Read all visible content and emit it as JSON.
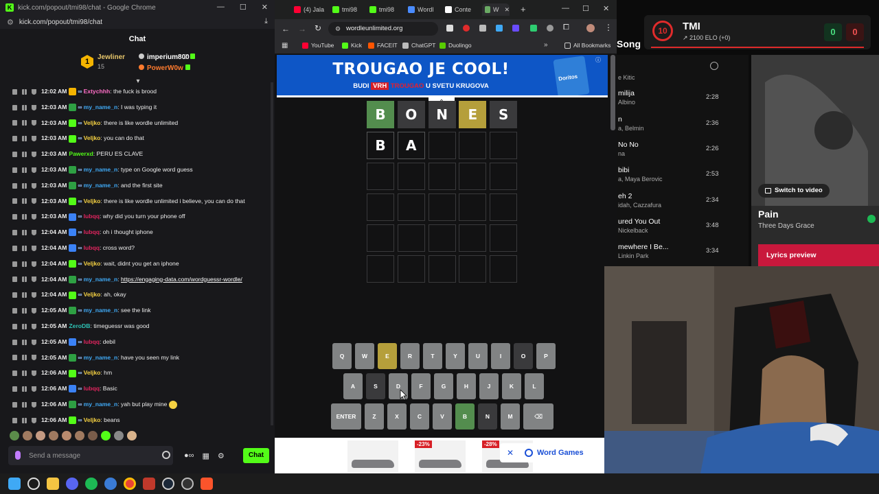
{
  "chat_window": {
    "title": "kick.com/popout/tmi98/chat - Google Chrome",
    "url": "kick.com/popout/tmi98/chat",
    "header": "Chat",
    "leaderboard": {
      "first_name": "Jewliner",
      "first_count": "15",
      "second_name": "imperium800",
      "second_count": "2",
      "third_name": "PowerW0w",
      "first_rank": "1"
    },
    "messages": [
      {
        "time": "12:02 AM",
        "user": "Extychhh",
        "color": "#ff6ec7",
        "badge": "y",
        "text": ": the fuck is brood"
      },
      {
        "time": "12:03 AM",
        "user": "my_name_n",
        "color": "#3fa9f5",
        "badge": "g",
        "text": ": I was typing it"
      },
      {
        "time": "12:03 AM",
        "user": "Veljko",
        "color": "#f5d142",
        "badge": "k",
        "text": ": there is like wordle unlimited"
      },
      {
        "time": "12:03 AM",
        "user": "Veljko",
        "color": "#f5d142",
        "badge": "k",
        "text": ": you can do that"
      },
      {
        "time": "12:03 AM",
        "user": "Pawerxd",
        "color": "#53fc18",
        "badge": "",
        "text": ": PERU ES CLAVE"
      },
      {
        "time": "12:03 AM",
        "user": "my_name_n",
        "color": "#3fa9f5",
        "badge": "g",
        "text": ": type on Google word guess"
      },
      {
        "time": "12:03 AM",
        "user": "my_name_n",
        "color": "#3fa9f5",
        "badge": "g",
        "text": ": and the first site"
      },
      {
        "time": "12:03 AM",
        "user": "Veljko",
        "color": "#f5d142",
        "badge": "k",
        "text": ": there is like wordle unlimited i believe, you can do that"
      },
      {
        "time": "12:03 AM",
        "user": "lubqq",
        "color": "#e0245e",
        "badge": "b",
        "text": ": why did you turn your phone off"
      },
      {
        "time": "12:04 AM",
        "user": "lubqq",
        "color": "#e0245e",
        "badge": "b",
        "text": ": oh i thought iphone"
      },
      {
        "time": "12:04 AM",
        "user": "lubqq",
        "color": "#e0245e",
        "badge": "b",
        "text": ": cross word?"
      },
      {
        "time": "12:04 AM",
        "user": "Veljko",
        "color": "#f5d142",
        "badge": "k",
        "text": ": wait, didnt you get an iphone"
      },
      {
        "time": "12:04 AM",
        "user": "my_name_n",
        "color": "#3fa9f5",
        "badge": "g",
        "text": ": ",
        "link": "https://engaging-data.com/wordguessr-wordle/"
      },
      {
        "time": "12:04 AM",
        "user": "Veljko",
        "color": "#f5d142",
        "badge": "k",
        "text": ": ah, okay"
      },
      {
        "time": "12:05 AM",
        "user": "my_name_n",
        "color": "#3fa9f5",
        "badge": "g",
        "text": ": see the link"
      },
      {
        "time": "12:05 AM",
        "user": "ZeroDB",
        "color": "#2ec4b6",
        "badge": "",
        "text": ": timeguessr was good"
      },
      {
        "time": "12:05 AM",
        "user": "lubqq",
        "color": "#e0245e",
        "badge": "b",
        "text": ": debil"
      },
      {
        "time": "12:05 AM",
        "user": "my_name_n",
        "color": "#3fa9f5",
        "badge": "g",
        "text": ": have you seen my link"
      },
      {
        "time": "12:06 AM",
        "user": "Veljko",
        "color": "#f5d142",
        "badge": "k",
        "text": ": hm"
      },
      {
        "time": "12:06 AM",
        "user": "lubqq",
        "color": "#e0245e",
        "badge": "b",
        "text": ": Basic"
      },
      {
        "time": "12:06 AM",
        "user": "my_name_n",
        "color": "#3fa9f5",
        "badge": "g",
        "text": ": yah but play mine"
      },
      {
        "time": "12:06 AM",
        "user": "Veljko",
        "color": "#f5d142",
        "badge": "k",
        "text": ": beans"
      }
    ],
    "input_placeholder": "Send a message",
    "send_label": "Chat"
  },
  "browser": {
    "tabs": [
      {
        "label": "(4) Jala",
        "color": "#ff0033"
      },
      {
        "label": "tmi98",
        "color": "#53fc18"
      },
      {
        "label": "tmi98",
        "color": "#53fc18"
      },
      {
        "label": "Wordl",
        "color": "#4a8cff"
      },
      {
        "label": "Conte",
        "color": "#ffffff"
      },
      {
        "label": "W",
        "color": "#6aaa64"
      }
    ],
    "url": "wordleunlimited.org",
    "bookmarks": [
      {
        "label": "YouTube",
        "color": "#ff0033"
      },
      {
        "label": "Kick",
        "color": "#53fc18"
      },
      {
        "label": "FACEIT",
        "color": "#ff5500"
      },
      {
        "label": "ChatGPT",
        "color": "#bbbbbb"
      },
      {
        "label": "Duolingo",
        "color": "#58cc02"
      }
    ],
    "all_bookmarks": "All Bookmarks"
  },
  "ad": {
    "title": "TROUGAO JE COOL!",
    "sub_before": "BUDI",
    "sub_highlight": "VRH",
    "sub_brand": "TROUGAO",
    "sub_after": "U SVETU KRUGOVA",
    "bag_label": "Doritos"
  },
  "wordle": {
    "rows": [
      [
        {
          "l": "B",
          "s": "g"
        },
        {
          "l": "O",
          "s": "x"
        },
        {
          "l": "N",
          "s": "x"
        },
        {
          "l": "E",
          "s": "y"
        },
        {
          "l": "S",
          "s": "x"
        }
      ],
      [
        {
          "l": "B",
          "s": "f"
        },
        {
          "l": "A",
          "s": "f"
        },
        {
          "l": "",
          "s": ""
        },
        {
          "l": "",
          "s": ""
        },
        {
          "l": "",
          "s": ""
        }
      ],
      [
        {
          "l": "",
          "s": ""
        },
        {
          "l": "",
          "s": ""
        },
        {
          "l": "",
          "s": ""
        },
        {
          "l": "",
          "s": ""
        },
        {
          "l": "",
          "s": ""
        }
      ],
      [
        {
          "l": "",
          "s": ""
        },
        {
          "l": "",
          "s": ""
        },
        {
          "l": "",
          "s": ""
        },
        {
          "l": "",
          "s": ""
        },
        {
          "l": "",
          "s": ""
        }
      ],
      [
        {
          "l": "",
          "s": ""
        },
        {
          "l": "",
          "s": ""
        },
        {
          "l": "",
          "s": ""
        },
        {
          "l": "",
          "s": ""
        },
        {
          "l": "",
          "s": ""
        }
      ],
      [
        {
          "l": "",
          "s": ""
        },
        {
          "l": "",
          "s": ""
        },
        {
          "l": "",
          "s": ""
        },
        {
          "l": "",
          "s": ""
        },
        {
          "l": "",
          "s": ""
        }
      ]
    ],
    "keyboard": [
      [
        {
          "k": "Q"
        },
        {
          "k": "W"
        },
        {
          "k": "E",
          "s": "y"
        },
        {
          "k": "R"
        },
        {
          "k": "T"
        },
        {
          "k": "Y"
        },
        {
          "k": "U"
        },
        {
          "k": "I"
        },
        {
          "k": "O",
          "s": "x"
        },
        {
          "k": "P"
        }
      ],
      [
        {
          "k": "A"
        },
        {
          "k": "S",
          "s": "x"
        },
        {
          "k": "D"
        },
        {
          "k": "F"
        },
        {
          "k": "G"
        },
        {
          "k": "H"
        },
        {
          "k": "J"
        },
        {
          "k": "K"
        },
        {
          "k": "L"
        }
      ],
      [
        {
          "k": "ENTER",
          "wide": true
        },
        {
          "k": "Z"
        },
        {
          "k": "X"
        },
        {
          "k": "C"
        },
        {
          "k": "V"
        },
        {
          "k": "B",
          "s": "g"
        },
        {
          "k": "N",
          "s": "x"
        },
        {
          "k": "M"
        },
        {
          "k": "⌫",
          "wide": true
        }
      ]
    ]
  },
  "bottom_ad": {
    "discounts": [
      "",
      "-23%",
      "-28%"
    ],
    "word_games": "Word Games"
  },
  "faceit": {
    "level": "10",
    "name": "TMI",
    "elo": "2100 ELO (+0)",
    "wins": "0",
    "losses": "0"
  },
  "music": {
    "heading": "Song",
    "tracks": [
      {
        "title": "",
        "artist": "e Kitic",
        "duration": ""
      },
      {
        "title": "milija",
        "artist": "Albino",
        "duration": "2:28"
      },
      {
        "title": "n",
        "artist": "a, Belmin",
        "duration": "2:36"
      },
      {
        "title": "No No",
        "artist": "na",
        "duration": "2:26"
      },
      {
        "title": "bibi",
        "artist": "a, Maya Berovic",
        "duration": "2:53"
      },
      {
        "title": "eh 2",
        "artist": "idah, Cazzafura",
        "duration": "2:34"
      },
      {
        "title": "ured You Out",
        "artist": "Nickelback",
        "duration": "3:48"
      },
      {
        "title": "mewhere I Be...",
        "artist": "Linkin Park",
        "duration": "3:34"
      }
    ],
    "switch_label": "Switch to video",
    "now_title": "Pain",
    "now_artist": "Three Days Grace",
    "lyrics_label": "Lyrics preview"
  }
}
